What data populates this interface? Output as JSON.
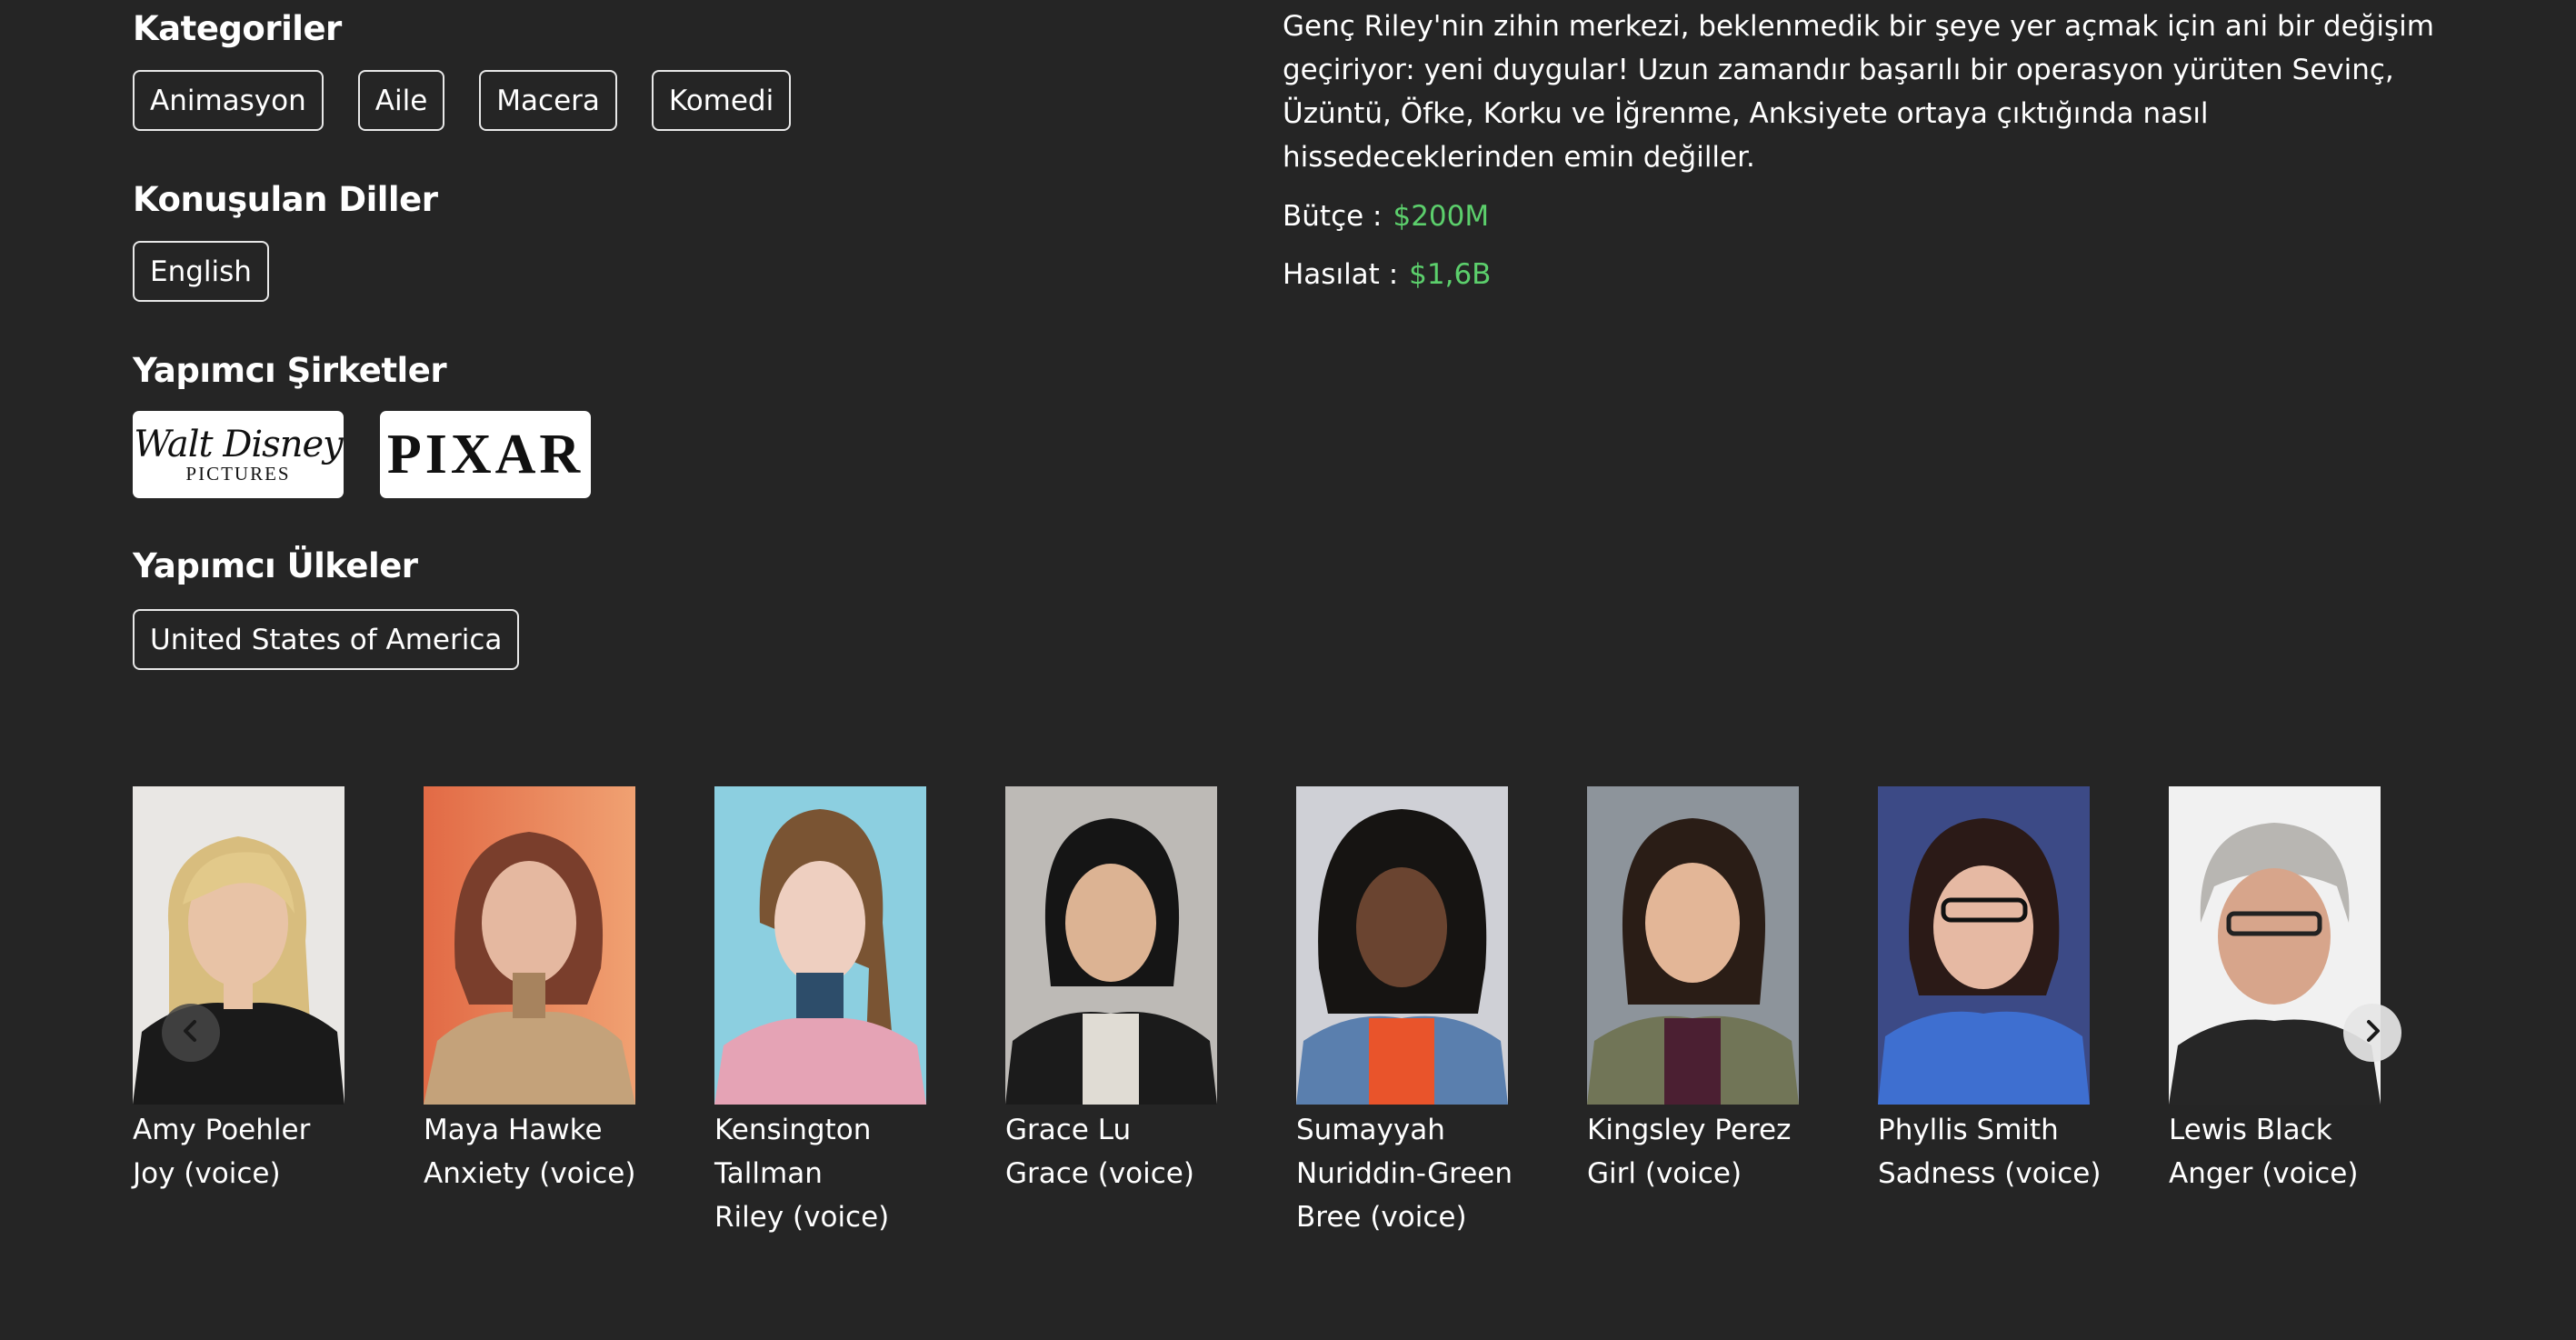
{
  "sections": {
    "categories_title": "Kategoriler",
    "languages_title": "Konuşulan Diller",
    "companies_title": "Yapımcı Şirketler",
    "countries_title": "Yapımcı Ülkeler"
  },
  "categories": [
    "Animasyon",
    "Aile",
    "Macera",
    "Komedi"
  ],
  "languages": [
    "English"
  ],
  "companies": [
    {
      "name": "Walt Disney Pictures",
      "logo_line1": "Walt Disney",
      "logo_line2": "PICTURES"
    },
    {
      "name": "Pixar",
      "logo_text": "PIXAR"
    }
  ],
  "countries": [
    "United States of America"
  ],
  "overview": "Genç Riley'nin zihin merkezi, beklenmedik bir şeye yer açmak için ani bir değişim geçiriyor: yeni duygular! Uzun zamandır başarılı bir operasyon yürüten Sevinç, Üzüntü, Öfke, Korku ve İğrenme, Anksiyete ortaya çıktığında nasıl hissedeceklerinden emin değiller.",
  "budget": {
    "label": "Bütçe :",
    "value": "$200M"
  },
  "revenue": {
    "label": "Hasılat :",
    "value": "$1,6B"
  },
  "colors": {
    "background": "#252525",
    "money": "#5ccf6c",
    "chip_border": "#e8e8e8"
  },
  "cast": [
    {
      "name": "Amy Poehler",
      "role": "Joy (voice)"
    },
    {
      "name": "Maya Hawke",
      "role": "Anxiety (voice)"
    },
    {
      "name": "Kensington Tallman",
      "role": "Riley (voice)"
    },
    {
      "name": "Grace Lu",
      "role": "Grace (voice)"
    },
    {
      "name": "Sumayyah Nuriddin-Green",
      "role": "Bree (voice)"
    },
    {
      "name": "Kingsley Perez",
      "role": "Girl (voice)"
    },
    {
      "name": "Phyllis Smith",
      "role": "Sadness (voice)"
    },
    {
      "name": "Lewis Black",
      "role": "Anger (voice)"
    }
  ],
  "carousel": {
    "prev_icon": "chevron-left-icon",
    "next_icon": "chevron-right-icon"
  }
}
